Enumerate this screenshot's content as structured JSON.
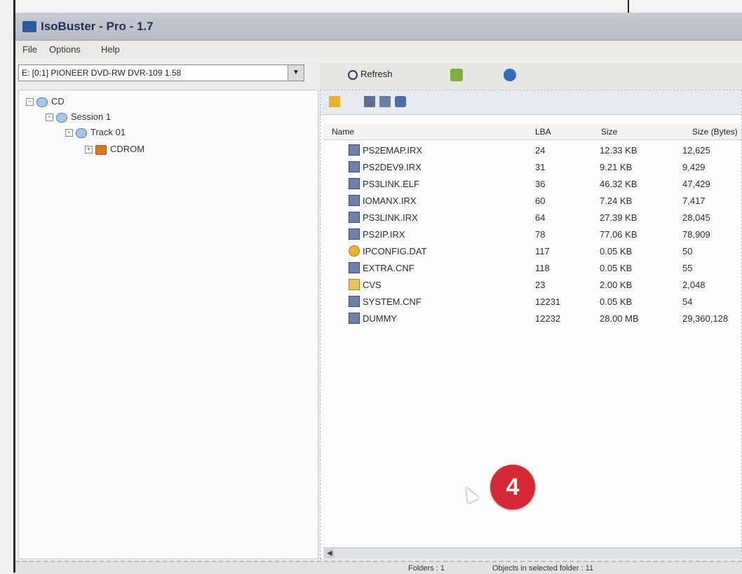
{
  "window": {
    "title": "IsoBuster - Pro - 1.7"
  },
  "menu": [
    "File",
    "Options",
    "Help"
  ],
  "drive": {
    "selected": "E: [0:1] PIONEER  DVD-RW  DVR-109  1.58"
  },
  "toolbar": {
    "refresh_label": "Refresh"
  },
  "tree": {
    "cd": "CD",
    "session": "Session 1",
    "track": "Track 01",
    "cdrom": "CDROM"
  },
  "table": {
    "headers": [
      "Name",
      "LBA",
      "Size",
      "Size (Bytes)"
    ],
    "rows": [
      {
        "name": "PS2EMAP.IRX",
        "lba": "24",
        "size": "12.33 KB",
        "bytes": "12,625",
        "icon": "file-icon"
      },
      {
        "name": "PS2DEV9.IRX",
        "lba": "31",
        "size": "9.21 KB",
        "bytes": "9,429",
        "icon": "file-icon"
      },
      {
        "name": "PS3LINK.ELF",
        "lba": "36",
        "size": "46.32 KB",
        "bytes": "47,429",
        "icon": "file-icon"
      },
      {
        "name": "IOMANX.IRX",
        "lba": "60",
        "size": "7.24 KB",
        "bytes": "7,417",
        "icon": "file-icon"
      },
      {
        "name": "PS3LINK.IRX",
        "lba": "64",
        "size": "27.39 KB",
        "bytes": "28,045",
        "icon": "file-icon"
      },
      {
        "name": "PS2IP.IRX",
        "lba": "78",
        "size": "77.06 KB",
        "bytes": "78,909",
        "icon": "file-icon"
      },
      {
        "name": "IPCONFIG.DAT",
        "lba": "117",
        "size": "0.05 KB",
        "bytes": "50",
        "icon": "gear-icon"
      },
      {
        "name": "EXTRA.CNF",
        "lba": "118",
        "size": "0.05 KB",
        "bytes": "55",
        "icon": "file-icon"
      },
      {
        "name": "CVS",
        "lba": "23",
        "size": "2.00 KB",
        "bytes": "2,048",
        "icon": "folder-icon"
      },
      {
        "name": "SYSTEM.CNF",
        "lba": "12231",
        "size": "0.05 KB",
        "bytes": "54",
        "icon": "file-icon"
      },
      {
        "name": "DUMMY",
        "lba": "12232",
        "size": "28.00 MB",
        "bytes": "29,360,128",
        "icon": "file-icon"
      }
    ]
  },
  "status": {
    "folders": "Folders : 1",
    "objects": "Objects in selected folder : 11"
  },
  "annotation": {
    "badge": "4"
  }
}
